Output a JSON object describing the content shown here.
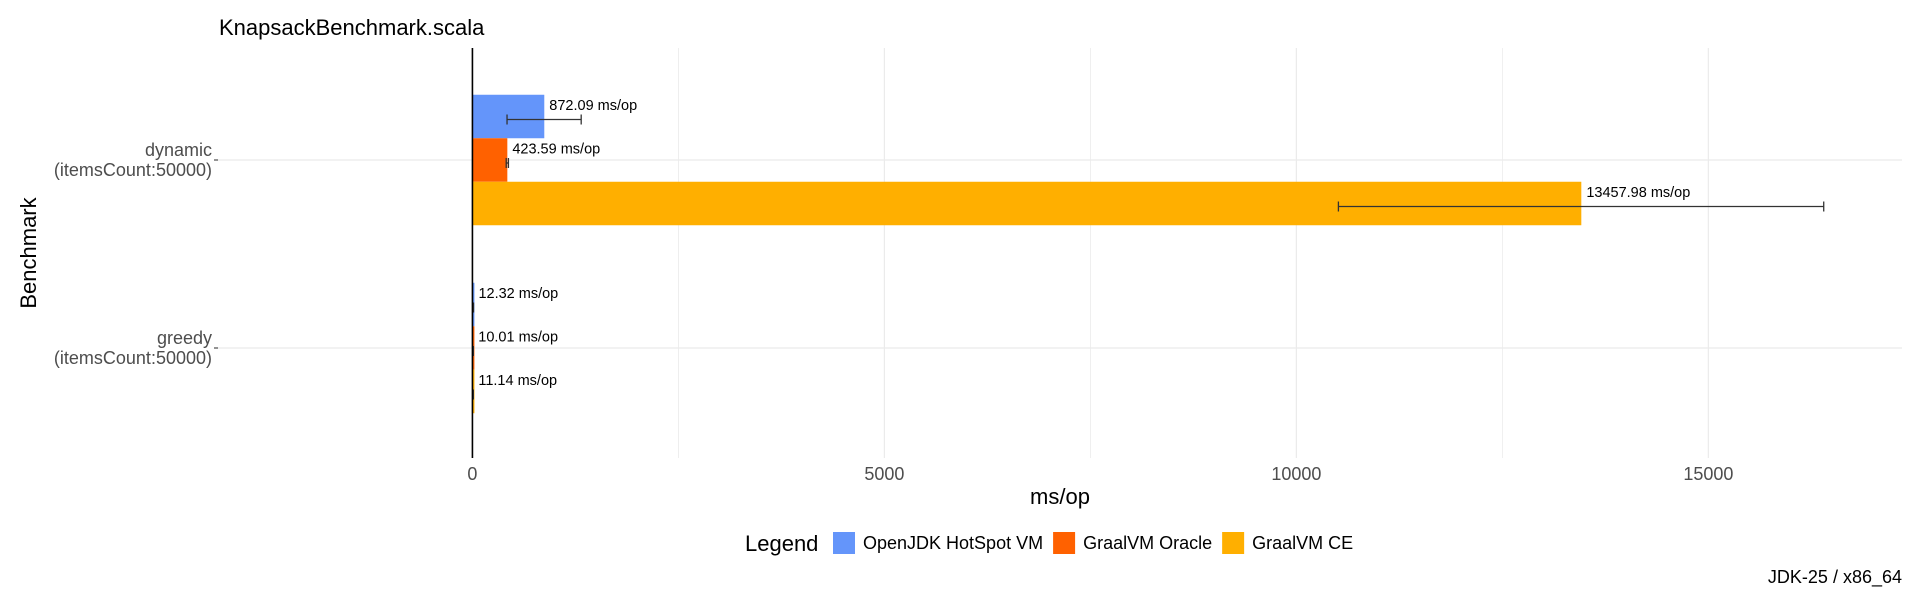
{
  "chart_data": {
    "type": "bar",
    "orientation": "horizontal",
    "title": "KnapsackBenchmark.scala",
    "xlabel": "ms/op",
    "ylabel": "Benchmark",
    "xlim": [
      -3100,
      17350
    ],
    "xticks": [
      0,
      5000,
      10000,
      15000
    ],
    "grid": true,
    "legend_title": "Legend",
    "legend_position": "bottom",
    "caption": "JDK-25 / x86_64",
    "categories": [
      "greedy\n(itemsCount:50000)",
      "dynamic\n(itemsCount:50000)"
    ],
    "series": [
      {
        "name": "OpenJDK HotSpot VM",
        "color": "#6495FA",
        "values": [
          12.32,
          872.09
        ],
        "labels": [
          "12.32 ms/op",
          "872.09 ms/op"
        ],
        "error": [
          [
            12.0,
            12.6
          ],
          [
            420,
            1320
          ]
        ]
      },
      {
        "name": "GraalVM Oracle",
        "color": "#FF6100",
        "values": [
          10.01,
          423.59
        ],
        "labels": [
          "10.01 ms/op",
          "423.59 ms/op"
        ],
        "error": [
          [
            9.8,
            10.2
          ],
          [
            410,
            437
          ]
        ]
      },
      {
        "name": "GraalVM CE",
        "color": "#FFAF00",
        "values": [
          11.14,
          13457.98
        ],
        "labels": [
          "11.14 ms/op",
          "13457.98 ms/op"
        ],
        "error": [
          [
            10.9,
            11.4
          ],
          [
            10510,
            16400
          ]
        ]
      }
    ]
  }
}
